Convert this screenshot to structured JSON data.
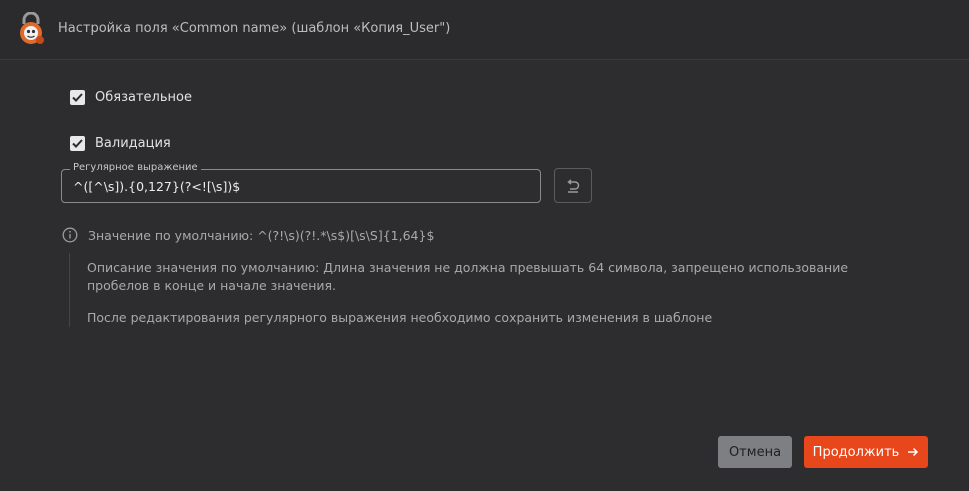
{
  "window": {
    "title": "Настройка поля «Common name» (шаблон «Копия_User\")"
  },
  "form": {
    "required": {
      "label": "Обязательное",
      "checked": true
    },
    "validation": {
      "label": "Валидация",
      "checked": true
    },
    "regex": {
      "legend": "Регулярное выражение",
      "value": "^([^\\s]).{0,127}(?<![\\s])$"
    },
    "default_info": "Значение по умолчанию: ^(?!\\s)(?!.*\\s$)[\\s\\S]{1,64}$",
    "description": "Описание значения по умолчанию: Длина значения не должна превышать 64 символа, запрещено использование пробелов в конце и начале значения.",
    "note": "После редактирования регулярного выражения необходимо сохранить изменения в шаблоне"
  },
  "actions": {
    "cancel_label": "Отмена",
    "continue_label": "Продолжить"
  },
  "colors": {
    "accent": "#e8461b",
    "background": "#2d2d2f",
    "cancel_button": "#7d7f82"
  },
  "icons": [
    "app-logo-icon",
    "checkmark-icon",
    "undo-icon",
    "info-icon",
    "arrow-right-icon"
  ]
}
